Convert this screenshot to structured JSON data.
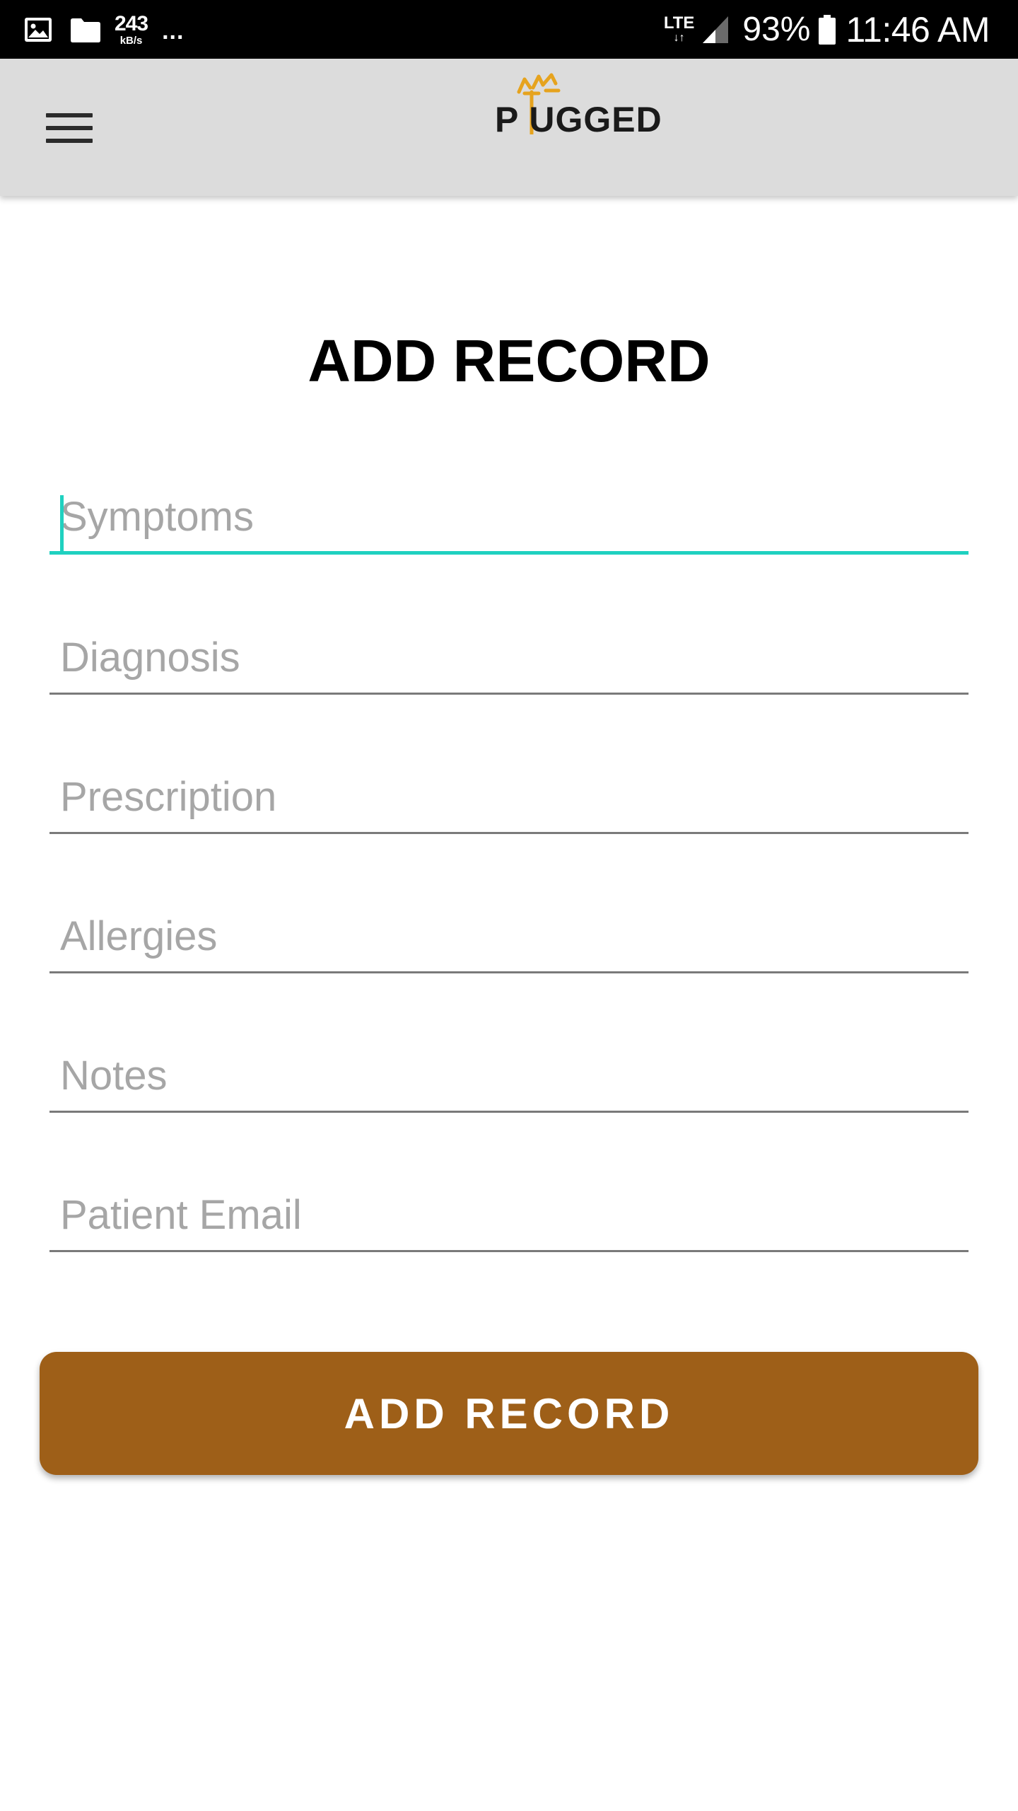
{
  "status_bar": {
    "net_speed_value": "243",
    "net_speed_unit": "kB/s",
    "more_dots": "...",
    "network_type": "LTE",
    "network_arrows": "↓↑",
    "battery_percent": "93%",
    "time": "11:46 AM",
    "icons": [
      "gallery-icon",
      "folder-icon",
      "signal-icon",
      "battery-icon"
    ]
  },
  "app_bar": {
    "logo_text": "P UGGED",
    "logo_color": "#e6a31e",
    "menu_icon": "hamburger-menu-icon"
  },
  "form": {
    "title": "ADD RECORD",
    "fields": [
      {
        "placeholder": "Symptoms",
        "value": ""
      },
      {
        "placeholder": "Diagnosis",
        "value": ""
      },
      {
        "placeholder": "Prescription",
        "value": ""
      },
      {
        "placeholder": "Allergies",
        "value": ""
      },
      {
        "placeholder": "Notes",
        "value": ""
      },
      {
        "placeholder": "Patient Email",
        "value": ""
      }
    ],
    "submit_label": "ADD RECORD"
  },
  "colors": {
    "status_bar": "#000000",
    "app_bar": "#dcdcdc",
    "accent_focus": "#1fd1c0",
    "button": "#9e5f18",
    "logo_accent": "#e6a31e"
  }
}
